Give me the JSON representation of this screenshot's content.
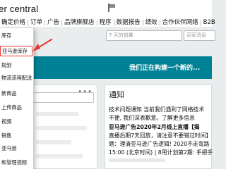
{
  "app": {
    "logo_text": "ler central"
  },
  "nav": {
    "items": [
      "确定价格",
      "订单",
      "广告",
      "品牌旗舰店",
      "程序",
      "数据报告",
      "绩效",
      "合作伙伴网络",
      "B2B"
    ]
  },
  "search_row": {
    "field1_placeholder": "7 天的销量",
    "field2_placeholder": "买家消息"
  },
  "dropdown": {
    "items": [
      "库存",
      "亚马逊库存",
      "规划",
      "物流流程配送",
      "新商品",
      "上传商品",
      "视频",
      "销售",
      "亚马逊",
      "和管理视频"
    ]
  },
  "banner": {
    "text": "我们正在构建一个新的..."
  },
  "left_panel": {
    "menu_dots": "•••"
  },
  "notice": {
    "title": "通知",
    "lines": [
      "技术问题通知 当前我们遇到了网络技术",
      "不便, 我们深表歉意。了解更多信息",
      "亚马逊广告2020年2月线上直播【揭",
      "直播后期7天回放，请注意不要错过时间】",
      "题：理清亚马逊广告逻辑! 2020不走弯路",
      "15:00 (北京时间) | 8用计划第2期: 手把手"
    ]
  },
  "colors": {
    "banner": "#008296",
    "highlight": "#e53935",
    "link": "#0066c0"
  }
}
